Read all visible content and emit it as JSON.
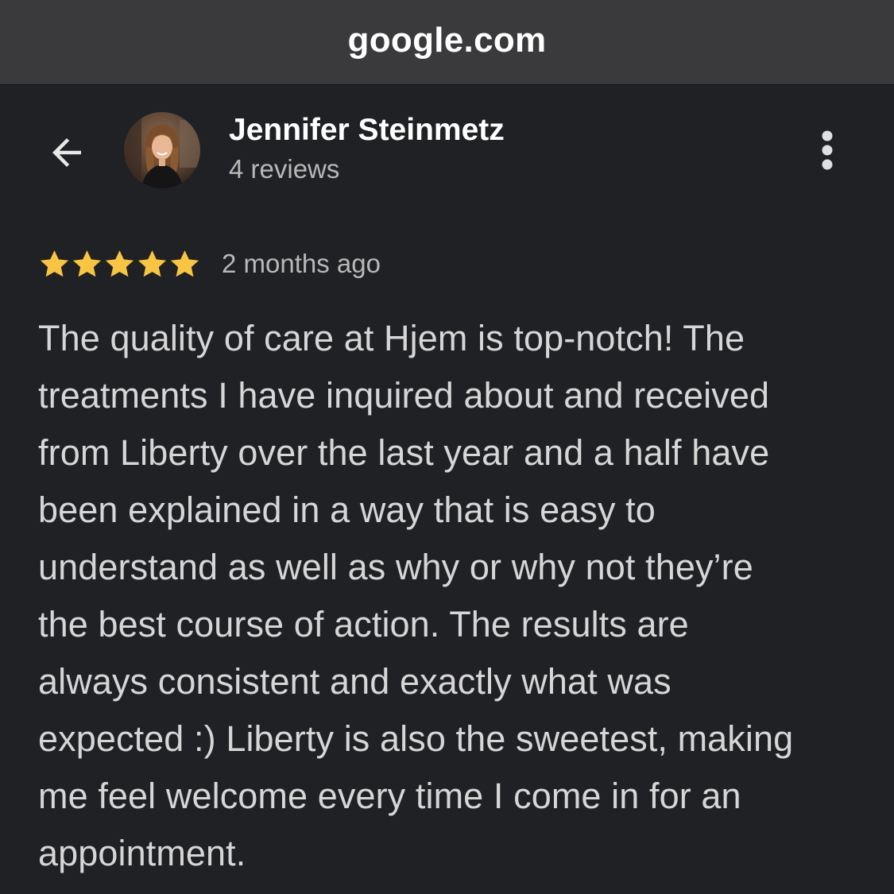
{
  "browser": {
    "url": "google.com"
  },
  "icons": {
    "back": "arrow-left-icon",
    "more": "more-vertical-icon",
    "star": "star-icon"
  },
  "colors": {
    "background": "#202124",
    "url_bar": "#3a3a3c",
    "star": "#f8c443",
    "primary_text": "#ffffff",
    "secondary_text": "#b8b8b8",
    "body_text": "#d6d6d6"
  },
  "reviewer": {
    "name": "Jennifer Steinmetz",
    "review_count": "4 reviews"
  },
  "review": {
    "rating": 5,
    "max_rating": 5,
    "time_ago": "2 months ago",
    "text_lines": [
      "The quality of care at Hjem is top-notch! The",
      "treatments I have inquired about and received",
      "from Liberty over the last year and a half have",
      "been explained in a way that is easy to",
      "understand as well as why or why not they’re",
      "the best course of action. The results are",
      "always consistent and exactly what was",
      "expected :) Liberty is also the sweetest, making",
      "me feel welcome every time I come in for an",
      "appointment."
    ]
  }
}
